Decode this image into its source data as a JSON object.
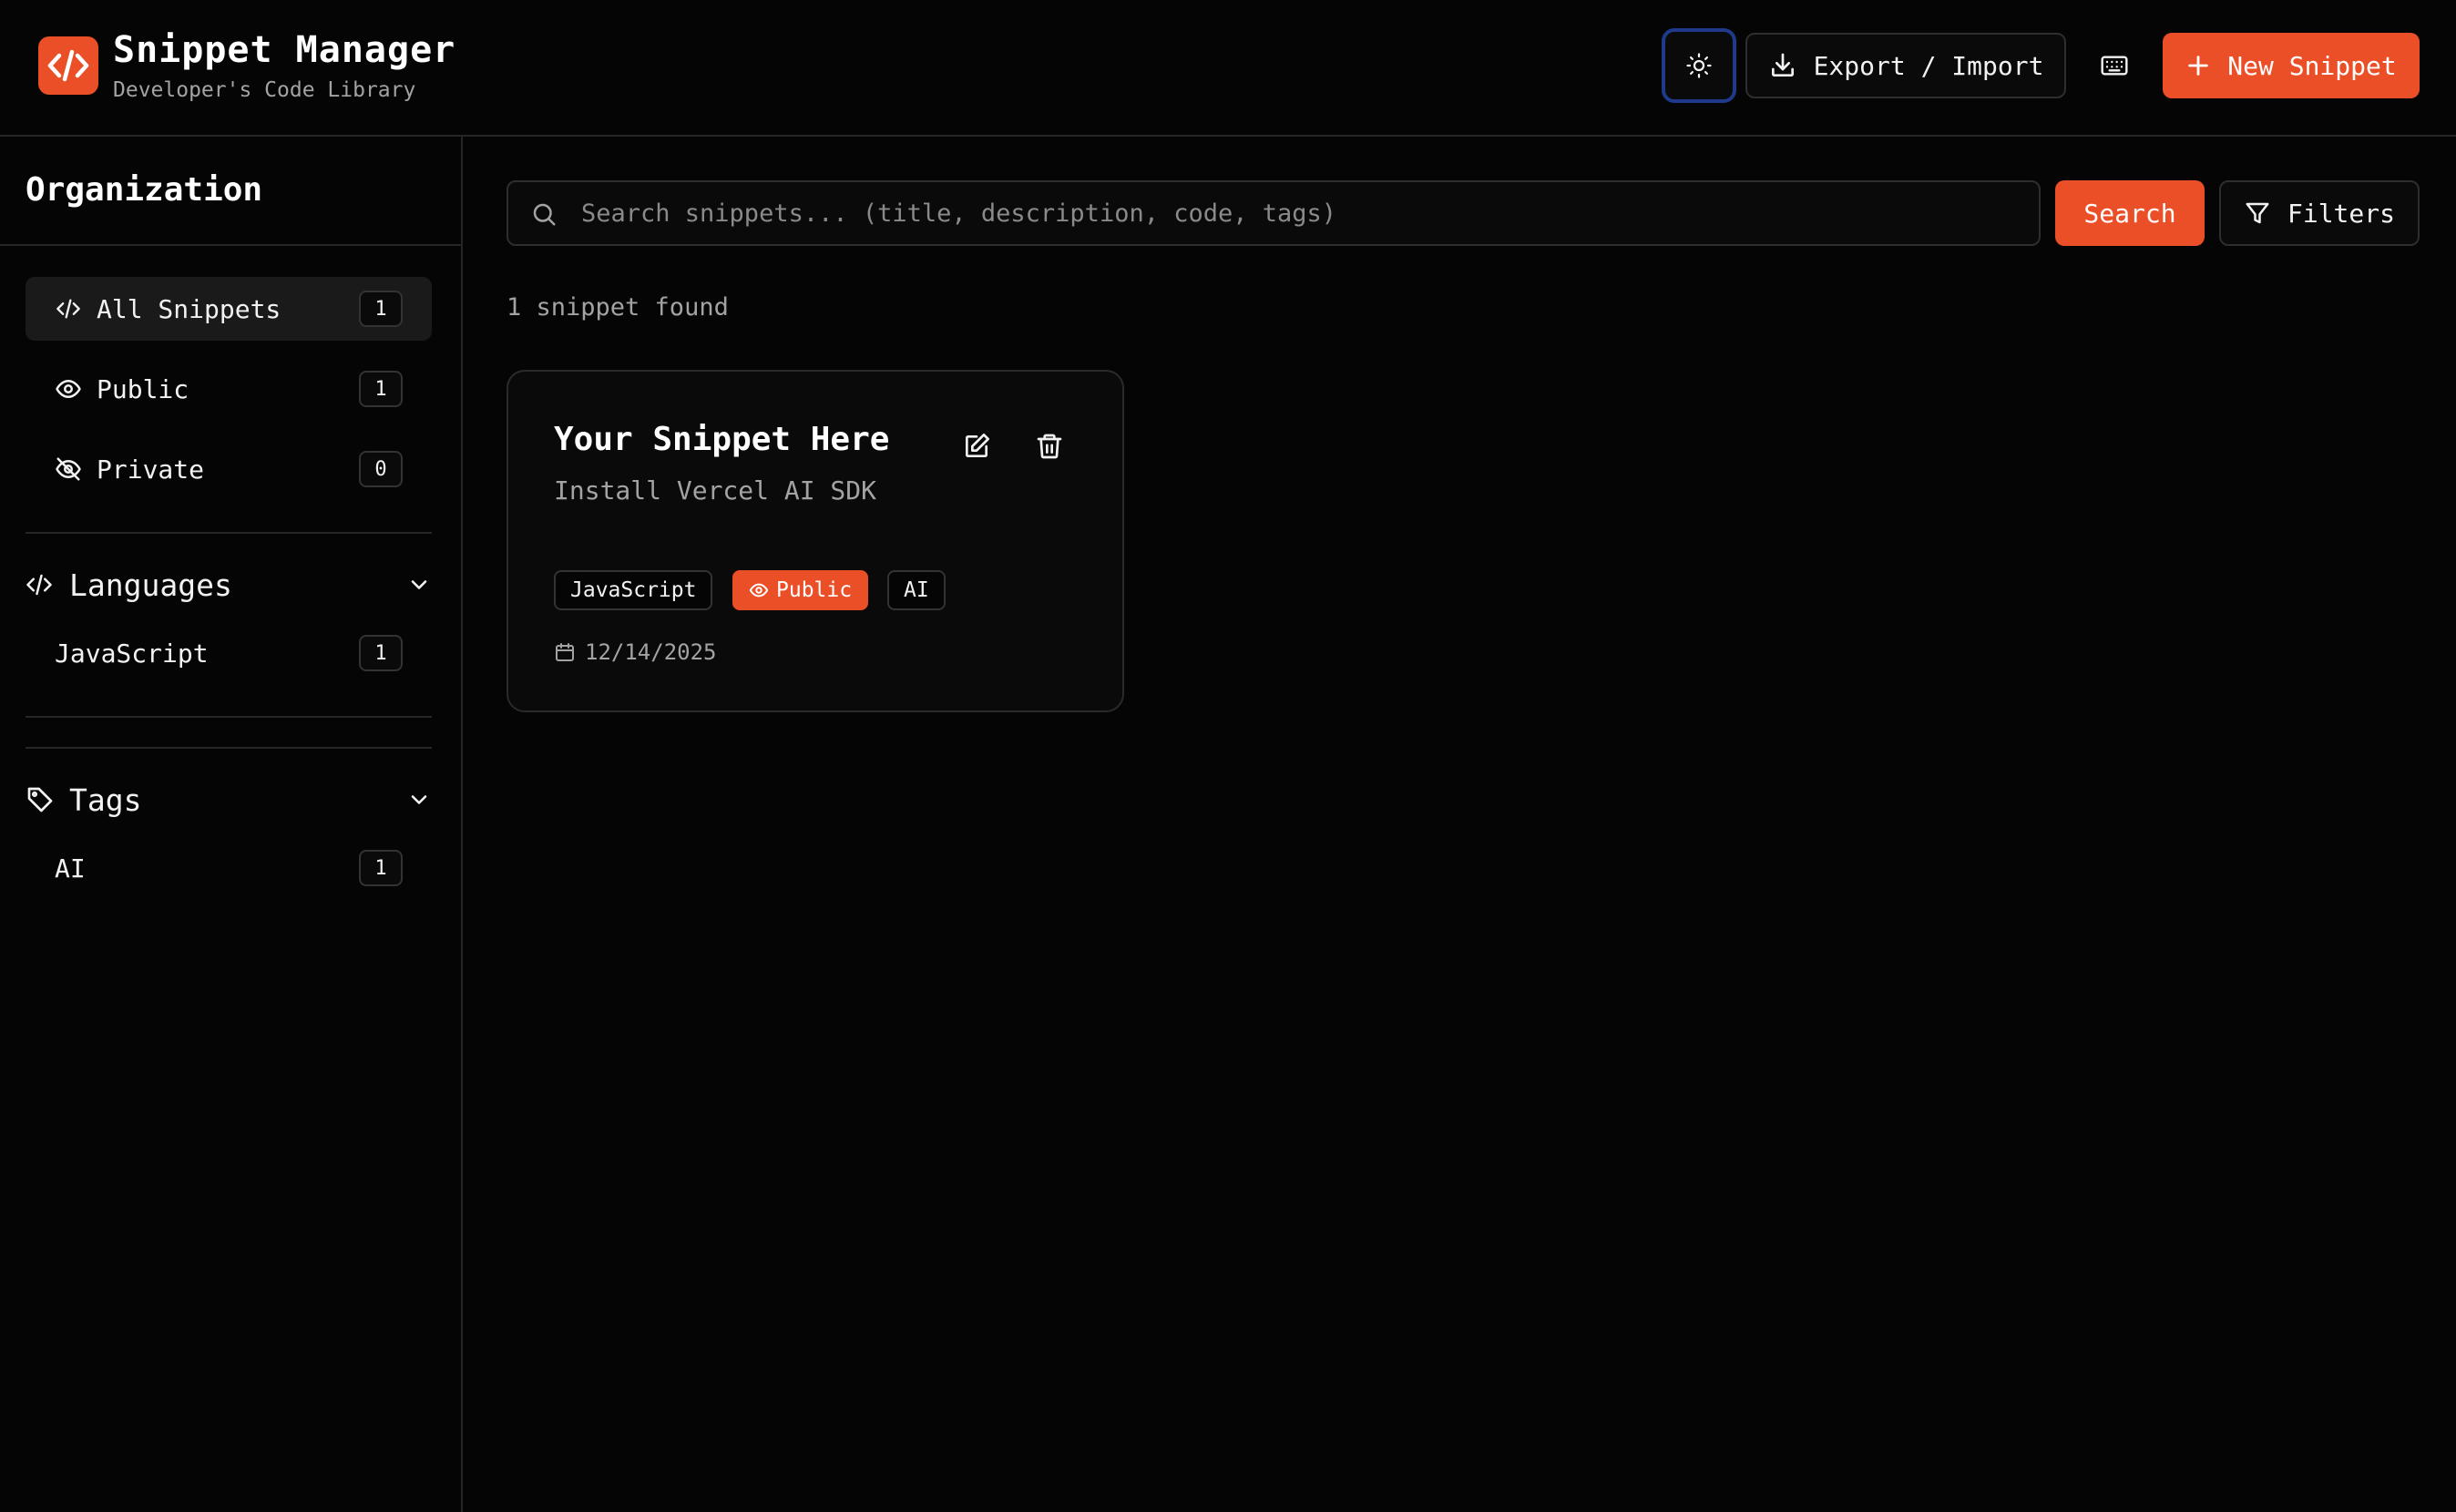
{
  "header": {
    "app_title": "Snippet Manager",
    "app_subtitle": "Developer's Code Library",
    "theme_icon": "sun-icon",
    "export_import_label": "Export / Import",
    "keyboard_icon": "keyboard-icon",
    "new_snippet_label": "New Snippet",
    "accent_color": "#eb4f27"
  },
  "sidebar": {
    "title": "Organization",
    "items": [
      {
        "label": "All Snippets",
        "count": "1",
        "icon": "code-icon",
        "active": true
      },
      {
        "label": "Public",
        "count": "1",
        "icon": "eye-icon"
      },
      {
        "label": "Private",
        "count": "0",
        "icon": "eye-off-icon"
      }
    ],
    "languages": {
      "title": "Languages",
      "items": [
        {
          "label": "JavaScript",
          "count": "1"
        }
      ]
    },
    "tags": {
      "title": "Tags",
      "items": [
        {
          "label": "AI",
          "count": "1"
        }
      ]
    }
  },
  "search": {
    "placeholder": "Search snippets... (title, description, code, tags)",
    "value": "",
    "search_label": "Search",
    "filters_label": "Filters"
  },
  "results": {
    "count_text": "1 snippet found",
    "snippets": [
      {
        "title": "Your Snippet Here",
        "description": "Install Vercel AI SDK",
        "language": "JavaScript",
        "visibility": "Public",
        "tags": [
          "AI"
        ],
        "date": "12/14/2025"
      }
    ]
  }
}
